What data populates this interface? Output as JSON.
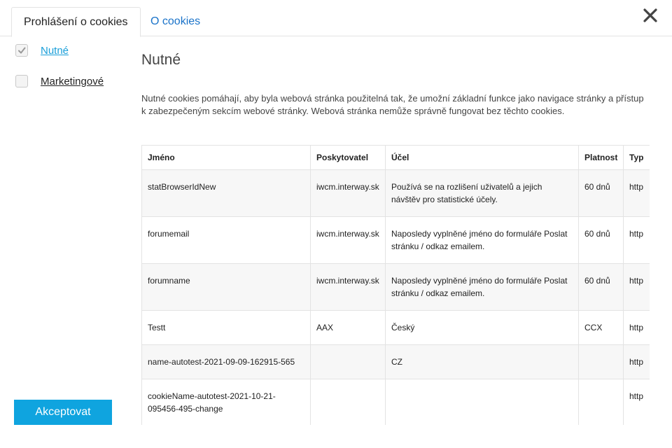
{
  "tabs": [
    {
      "label": "Prohlášení o cookies",
      "active": true
    },
    {
      "label": "O cookies",
      "active": false
    }
  ],
  "sidebar": {
    "categories": [
      {
        "label": "Nutné",
        "checked": true,
        "disabled": true
      },
      {
        "label": "Marketingové",
        "checked": false,
        "disabled": false
      }
    ],
    "accept_label": "Akceptovat"
  },
  "main": {
    "title": "Nutné",
    "description": "Nutné cookies pomáhají, aby byla webová stránka použitelná tak, že umožní základní funkce jako navigace stránky a přístup k zabezpečeným sekcím webové stránky. Webová stránka nemůže správně fungovat bez těchto cookies.",
    "table": {
      "headers": [
        "Jméno",
        "Poskytovatel",
        "Účel",
        "Platnost",
        "Typ"
      ],
      "rows": [
        [
          "statBrowserIdNew",
          "iwcm.interway.sk",
          "Používá se na rozlišení uživatelů a jejich návštěv pro statistické účely.",
          "60 dnů",
          "http"
        ],
        [
          "forumemail",
          "iwcm.interway.sk",
          "Naposledy vyplněné jméno do formuláře Poslat stránku / odkaz emailem.",
          "60 dnů",
          "http"
        ],
        [
          "forumname",
          "iwcm.interway.sk",
          "Naposledy vyplněné jméno do formuláře Poslat stránku / odkaz emailem.",
          "60 dnů",
          "http"
        ],
        [
          "Testt",
          "AAX",
          "Český",
          "CCX",
          "http"
        ],
        [
          "name-autotest-2021-09-09-162915-565",
          "",
          "CZ",
          "",
          "http"
        ],
        [
          "cookieName-autotest-2021-10-21-095456-495-change",
          "",
          "",
          "",
          "http"
        ]
      ]
    }
  },
  "colors": {
    "accent": "#0fa4df",
    "link": "#1a73c9",
    "active_category": "#1a9fd9"
  },
  "icons": {
    "close": "close-icon",
    "check": "checkmark-icon"
  }
}
